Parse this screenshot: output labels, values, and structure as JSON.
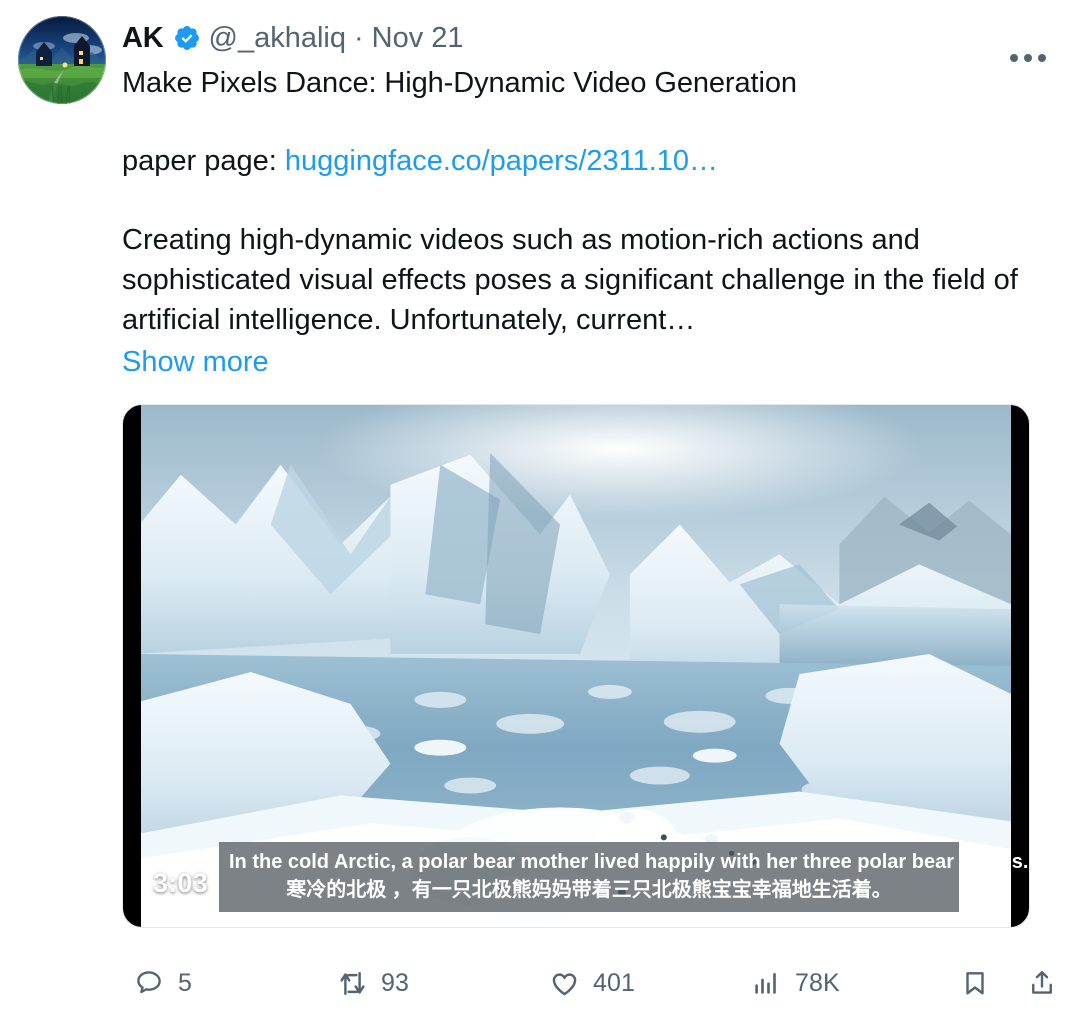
{
  "tweet": {
    "author": {
      "display_name": "AK",
      "handle": "@_akhaliq",
      "separator": "·",
      "date": "Nov 21",
      "verified": true,
      "verified_icon": "verified-badge-icon",
      "avatar_icon": "avatar-landscape-image"
    },
    "title": "Make Pixels Dance: High-Dynamic Video Generation",
    "paper_label": "paper page:",
    "paper_link": "huggingface.co/papers/2311.10…",
    "body": "Creating high-dynamic videos such as motion-rich actions and sophisticated visual effects poses a significant challenge in the field of artificial intelligence. Unfortunately, current…",
    "show_more": "Show more",
    "more_menu_icon": "more-horizontal-icon"
  },
  "video": {
    "duration": "3:03",
    "caption_en": "In the cold Arctic, a polar bear mother lived happily with her three polar bear babies.",
    "caption_zh": "寒冷的北极 ，有一只北极熊妈妈带着三只北极熊宝宝幸福地生活着。",
    "scene_description": "arctic-icebergs-polar-bears"
  },
  "actions": [
    {
      "name": "reply",
      "icon": "reply-bubble-icon",
      "count": "5"
    },
    {
      "name": "repost",
      "icon": "retweet-icon",
      "count": "93"
    },
    {
      "name": "like",
      "icon": "heart-icon",
      "count": "401"
    },
    {
      "name": "views",
      "icon": "analytics-bars-icon",
      "count": "78K"
    },
    {
      "name": "bookmark",
      "icon": "bookmark-icon",
      "count": ""
    },
    {
      "name": "share",
      "icon": "share-upload-icon",
      "count": ""
    }
  ],
  "colors": {
    "link": "#1d9bf0",
    "verified": "#1d9bf0",
    "text_primary": "#0f1419",
    "text_secondary": "#536471",
    "background": "#ffffff",
    "video_letterbox": "#000000"
  }
}
